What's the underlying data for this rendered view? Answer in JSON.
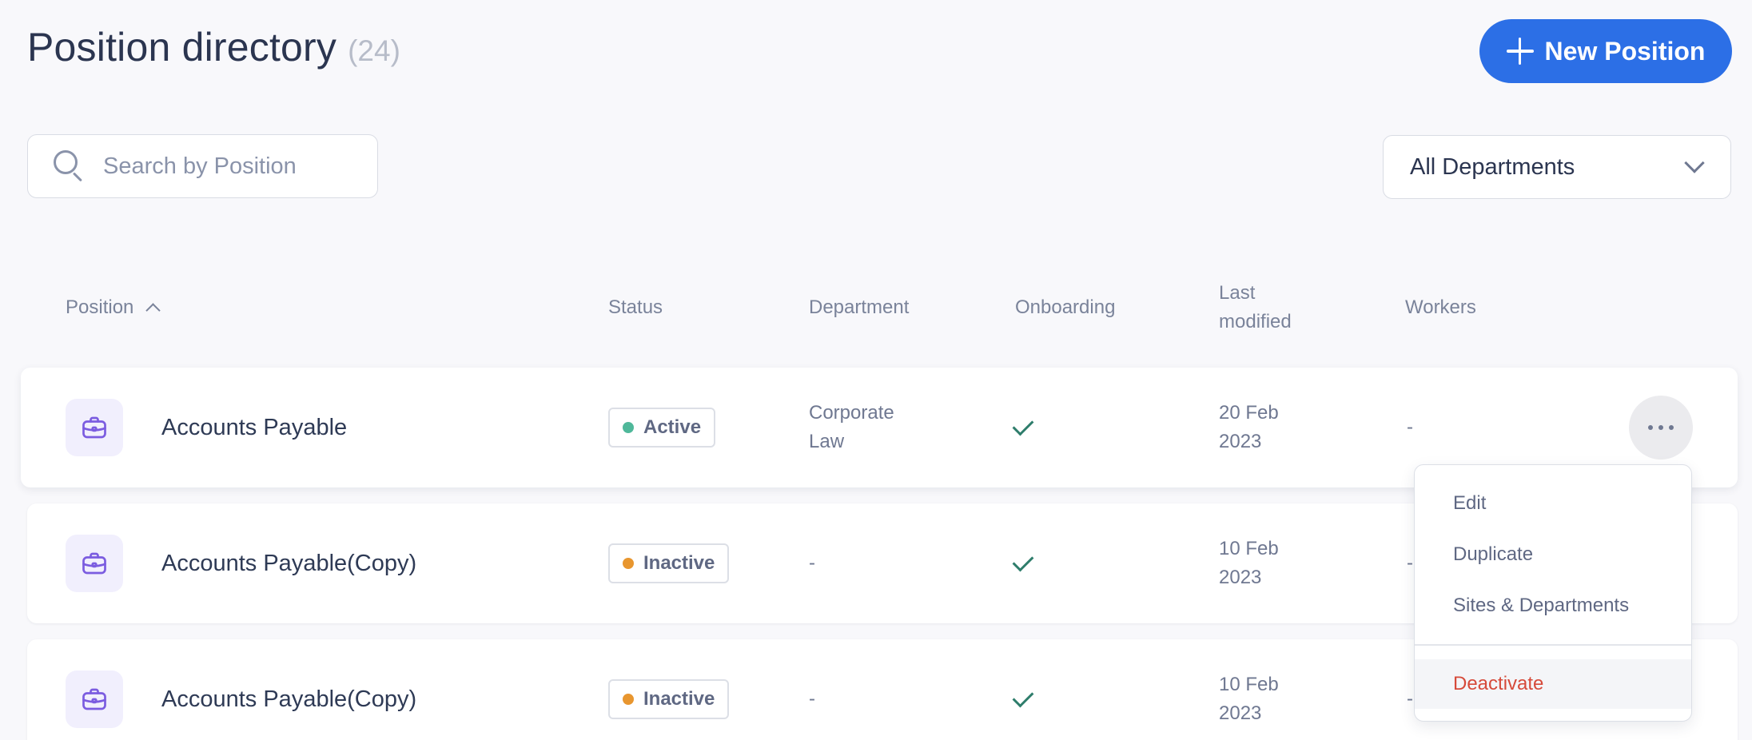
{
  "header": {
    "title": "Position directory",
    "count": "(24)",
    "new_button_label": "New Position"
  },
  "search": {
    "placeholder": "Search by Position",
    "value": ""
  },
  "department_filter": {
    "selected": "All Departments"
  },
  "table": {
    "columns": {
      "position": "Position",
      "status": "Status",
      "department": "Department",
      "onboarding": "Onboarding",
      "last_modified": "Last modified",
      "workers": "Workers"
    },
    "sort": {
      "column": "position",
      "direction": "ascending"
    },
    "rows": [
      {
        "position": "Accounts Payable",
        "status": "Active",
        "status_color": "#4fb89a",
        "department": "Corporate Law",
        "onboarding": "check",
        "last_modified": "20 Feb 2023",
        "workers": "-"
      },
      {
        "position": "Accounts Payable(Copy)",
        "status": "Inactive",
        "status_color": "#e8962f",
        "department": "-",
        "onboarding": "check",
        "last_modified": "10 Feb 2023",
        "workers": "-"
      },
      {
        "position": "Accounts Payable(Copy)",
        "status": "Inactive",
        "status_color": "#e8962f",
        "department": "-",
        "onboarding": "check",
        "last_modified": "10 Feb 2023",
        "workers": "-"
      }
    ]
  },
  "row_menu": {
    "items": [
      "Edit",
      "Duplicate",
      "Sites & Departments"
    ],
    "danger_item": "Deactivate"
  },
  "colors": {
    "accent": "#2c6fe6",
    "danger": "#d64a3a",
    "icon_purple": "#7b5ce0",
    "check_green": "#2e7d6b"
  },
  "icons": {
    "position": "briefcase-icon",
    "search": "search-icon",
    "dropdown": "chevron-down-icon",
    "sort": "chevron-up-icon",
    "more": "more-horizontal-icon",
    "new": "plus-icon",
    "onboarding": "checkmark-icon"
  }
}
